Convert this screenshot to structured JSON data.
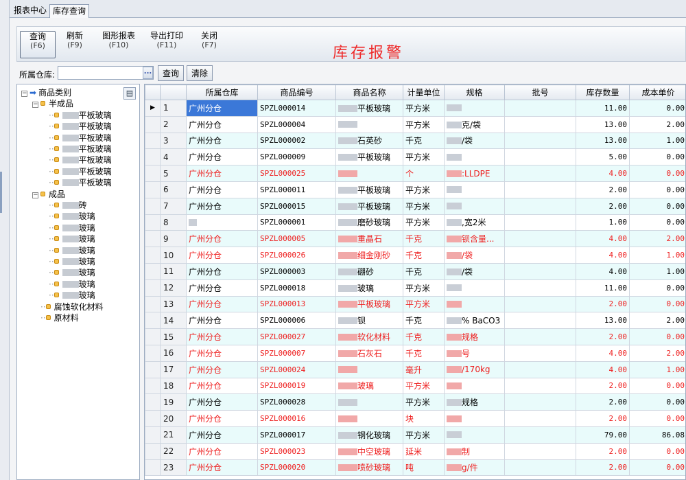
{
  "tabs": [
    "报表中心",
    "库存查询"
  ],
  "toolbar": [
    {
      "label": "查询",
      "key": "(F6)"
    },
    {
      "label": "刷新",
      "key": "(F9)"
    },
    {
      "label": "图形报表",
      "key": "(F10)"
    },
    {
      "label": "导出打印",
      "key": "(F11)"
    },
    {
      "label": "关闭",
      "key": "(F7)"
    }
  ],
  "report_title": "库存报警",
  "filter": {
    "label": "所属仓库:",
    "value": "",
    "browse": "...",
    "query": "查询",
    "clear": "清除"
  },
  "tree": {
    "root": "商品类别",
    "semi": "半成品",
    "semi_items": [
      "平板玻璃",
      "平板玻璃",
      "平板玻璃",
      "平板玻璃",
      "平板玻璃",
      "平板玻璃",
      "平板玻璃"
    ],
    "finished": "成品",
    "finished_items": [
      "砖",
      "玻璃",
      "玻璃",
      "玻璃",
      "玻璃",
      "玻璃",
      "玻璃",
      "玻璃",
      "玻璃"
    ],
    "others": [
      "腐蚀软化材料",
      "原材料"
    ]
  },
  "columns": [
    "所属仓库",
    "商品编号",
    "商品名称",
    "计量单位",
    "规格",
    "批号",
    "库存数量",
    "成本单价"
  ],
  "rows": [
    {
      "n": "1",
      "wh": "广州分仓",
      "code": "SPZL000014",
      "name": "平板玻璃",
      "unit": "平方米",
      "spec": "",
      "qty": "11.00",
      "cost": "0.00",
      "red": false
    },
    {
      "n": "2",
      "wh": "广州分仓",
      "code": "SPZL000004",
      "name": "",
      "unit": "平方米",
      "spec": "克/袋",
      "qty": "13.00",
      "cost": "2.00",
      "red": false
    },
    {
      "n": "3",
      "wh": "广州分仓",
      "code": "SPZL000002",
      "name": "石英砂",
      "unit": "千克",
      "spec": "/袋",
      "qty": "13.00",
      "cost": "1.00",
      "red": false
    },
    {
      "n": "4",
      "wh": "广州分仓",
      "code": "SPZL000009",
      "name": "平板玻璃",
      "unit": "平方米",
      "spec": "",
      "qty": "5.00",
      "cost": "0.00",
      "red": false
    },
    {
      "n": "5",
      "wh": "广州分仓",
      "code": "SPZL000025",
      "name": "",
      "unit": "个",
      "spec": ":LLDPE",
      "qty": "4.00",
      "cost": "0.00",
      "red": true
    },
    {
      "n": "6",
      "wh": "广州分仓",
      "code": "SPZL000011",
      "name": "平板玻璃",
      "unit": "平方米",
      "spec": "",
      "qty": "2.00",
      "cost": "0.00",
      "red": false
    },
    {
      "n": "7",
      "wh": "广州分仓",
      "code": "SPZL000015",
      "name": "平板玻璃",
      "unit": "平方米",
      "spec": "",
      "qty": "2.00",
      "cost": "0.00",
      "red": false
    },
    {
      "n": "8",
      "wh": "",
      "code": "SPZL000001",
      "name": "磨砂玻璃",
      "unit": "平方米",
      "spec": ",宽2米",
      "qty": "1.00",
      "cost": "0.00",
      "red": false
    },
    {
      "n": "9",
      "wh": "广州分仓",
      "code": "SPZL000005",
      "name": "重晶石",
      "unit": "千克",
      "spec": "钡含量...",
      "qty": "4.00",
      "cost": "2.00",
      "red": true
    },
    {
      "n": "10",
      "wh": "广州分仓",
      "code": "SPZL000026",
      "name": "细金刚砂",
      "unit": "千克",
      "spec": "/袋",
      "qty": "4.00",
      "cost": "1.00",
      "red": true
    },
    {
      "n": "11",
      "wh": "广州分仓",
      "code": "SPZL000003",
      "name": "硼砂",
      "unit": "千克",
      "spec": "/袋",
      "qty": "4.00",
      "cost": "1.00",
      "red": false
    },
    {
      "n": "12",
      "wh": "广州分仓",
      "code": "SPZL000018",
      "name": "玻璃",
      "unit": "平方米",
      "spec": "",
      "qty": "11.00",
      "cost": "0.00",
      "red": false
    },
    {
      "n": "13",
      "wh": "广州分仓",
      "code": "SPZL000013",
      "name": "平板玻璃",
      "unit": "平方米",
      "spec": "",
      "qty": "2.00",
      "cost": "0.00",
      "red": true
    },
    {
      "n": "14",
      "wh": "广州分仓",
      "code": "SPZL000006",
      "name": "钡",
      "unit": "千克",
      "spec": "% BaCO3",
      "qty": "13.00",
      "cost": "2.00",
      "red": false
    },
    {
      "n": "15",
      "wh": "广州分仓",
      "code": "SPZL000027",
      "name": "软化材料",
      "unit": "千克",
      "spec": "规格",
      "qty": "2.00",
      "cost": "0.00",
      "red": true
    },
    {
      "n": "16",
      "wh": "广州分仓",
      "code": "SPZL000007",
      "name": "石灰石",
      "unit": "千克",
      "spec": "号",
      "qty": "4.00",
      "cost": "2.00",
      "red": true
    },
    {
      "n": "17",
      "wh": "广州分仓",
      "code": "SPZL000024",
      "name": "",
      "unit": "毫升",
      "spec": "/170kg",
      "qty": "4.00",
      "cost": "1.00",
      "red": true
    },
    {
      "n": "18",
      "wh": "广州分仓",
      "code": "SPZL000019",
      "name": "玻璃",
      "unit": "平方米",
      "spec": "",
      "qty": "2.00",
      "cost": "0.00",
      "red": true
    },
    {
      "n": "19",
      "wh": "广州分仓",
      "code": "SPZL000028",
      "name": "",
      "unit": "平方米",
      "spec": "规格",
      "qty": "2.00",
      "cost": "0.00",
      "red": false
    },
    {
      "n": "20",
      "wh": "广州分仓",
      "code": "SPZL000016",
      "name": "",
      "unit": "块",
      "spec": "",
      "qty": "2.00",
      "cost": "0.00",
      "red": true
    },
    {
      "n": "21",
      "wh": "广州分仓",
      "code": "SPZL000017",
      "name": "钢化玻璃",
      "unit": "平方米",
      "spec": "",
      "qty": "79.00",
      "cost": "86.08",
      "red": false
    },
    {
      "n": "22",
      "wh": "广州分仓",
      "code": "SPZL000023",
      "name": "中空玻璃",
      "unit": "延米",
      "spec": "制",
      "qty": "2.00",
      "cost": "0.00",
      "red": true
    },
    {
      "n": "23",
      "wh": "广州分仓",
      "code": "SPZL000020",
      "name": "喷砂玻璃",
      "unit": "吨",
      "spec": "g/件",
      "qty": "2.00",
      "cost": "0.00",
      "red": true
    }
  ],
  "colors": {
    "red": "#ee1c1c",
    "cyan_row": "#e9fbfb",
    "selected": "#3b78d8"
  }
}
